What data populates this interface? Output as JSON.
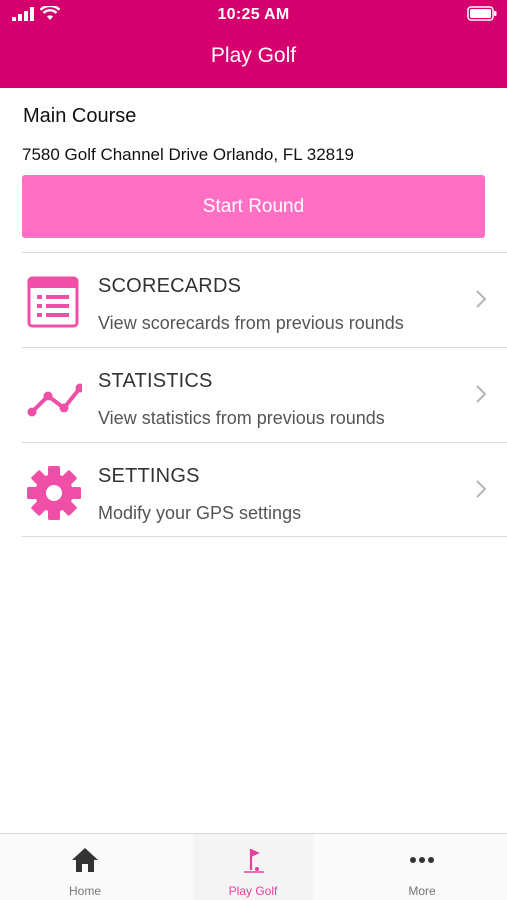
{
  "status_bar": {
    "time": "10:25 AM"
  },
  "header": {
    "title": "Play Golf"
  },
  "course": {
    "name": "Main Course",
    "address": "7580 Golf Channel Drive Orlando, FL 32819",
    "start_label": "Start Round"
  },
  "menu": [
    {
      "title": "SCORECARDS",
      "subtitle": "View scorecards from previous rounds",
      "icon": "scorecard-icon"
    },
    {
      "title": "STATISTICS",
      "subtitle": "View statistics from previous rounds",
      "icon": "statistics-chart-icon"
    },
    {
      "title": "SETTINGS",
      "subtitle": "Modify your GPS settings",
      "icon": "gear-icon"
    }
  ],
  "tabs": [
    {
      "label": "Home",
      "icon": "home-icon",
      "active": false
    },
    {
      "label": "Play Golf",
      "icon": "golf-flag-icon",
      "active": true
    },
    {
      "label": "More",
      "icon": "more-dots-icon",
      "active": false
    }
  ],
  "colors": {
    "header": "#d5006d",
    "button": "#ff6fc4",
    "accent": "#e8409f"
  }
}
